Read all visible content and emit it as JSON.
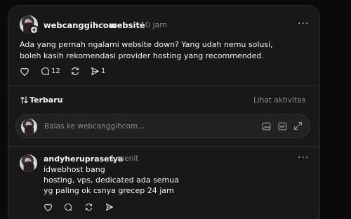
{
  "post": {
    "username": "webcanggihcom",
    "topic": "website",
    "time": "10 jam",
    "text": "Ada yang pernah ngalami website down? Yang udah nemu solusi, boleh kasih rekomendasi provider hosting yang recommended.",
    "reply_count": "12",
    "share_count": "1"
  },
  "activity": {
    "sort_label": "Terbaru",
    "view_activity": "Lihat aktivitas"
  },
  "reply_input": {
    "placeholder": "Balas ke webcanggihcom..."
  },
  "reply": {
    "username": "andyheruprasetya",
    "time": "1 menit",
    "lines": [
      "idwebhost bang",
      "hosting, vps, dedicated ada semua",
      "yg paling ok csnya grecep 24 jam"
    ]
  },
  "icons": {
    "heart": "heart-icon",
    "comment": "comment-icon",
    "repost": "repost-icon",
    "share": "send-icon",
    "more": "more-icon",
    "sort": "sort-arrows-icon",
    "image": "image-icon",
    "gif": "gif-icon",
    "expand": "expand-icon"
  }
}
